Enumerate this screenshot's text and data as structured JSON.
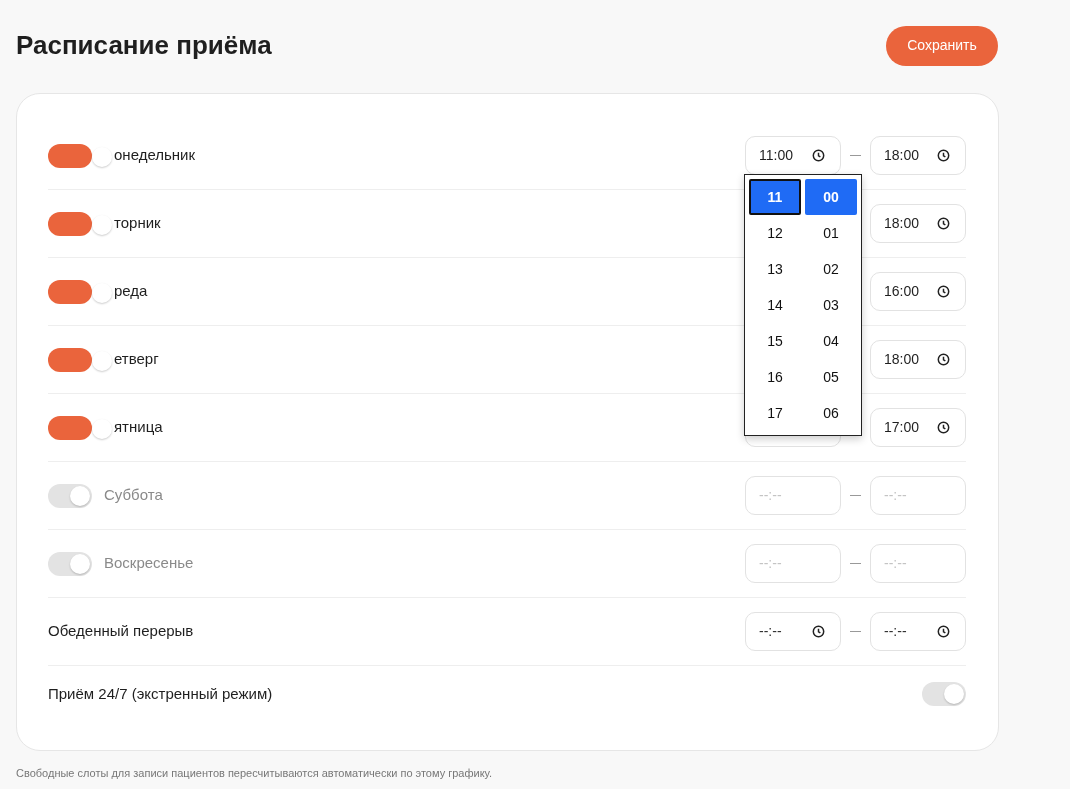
{
  "title": "Расписание приёма",
  "save_button": "Сохранить",
  "days": [
    {
      "label": "онедельник",
      "enabled": true,
      "start": {
        "value": "11:00",
        "expanded": true
      },
      "end": {
        "value": "18:00"
      }
    },
    {
      "label": "торник",
      "enabled": true,
      "end": {
        "value": "18:00"
      }
    },
    {
      "label": "реда",
      "enabled": true,
      "end": {
        "value": "16:00"
      }
    },
    {
      "label": "етверг",
      "enabled": true,
      "end": {
        "value": "18:00"
      }
    },
    {
      "label": "ятница",
      "enabled": true,
      "start": {
        "covered": true
      },
      "end": {
        "value": "17:00"
      }
    },
    {
      "label": "Суббота",
      "enabled": false,
      "start": {
        "placeholder": "--:--"
      },
      "end": {
        "placeholder": "--:--"
      }
    },
    {
      "label": "Воскресенье",
      "enabled": false,
      "start": {
        "placeholder": "--:--"
      },
      "end": {
        "placeholder": "--:--"
      }
    }
  ],
  "lunch_break": {
    "label": "Обеденный перерыв",
    "start": {
      "placeholder": "--:--"
    },
    "end": {
      "placeholder": "--:--"
    }
  },
  "emergency": {
    "label": "Приём 24/7 (экстренный режим)",
    "on": false
  },
  "time_picker": {
    "hours": [
      {
        "text": "11",
        "selected": true
      },
      {
        "text": "12",
        "selected": false
      },
      {
        "text": "13",
        "selected": false
      },
      {
        "text": "14",
        "selected": false
      },
      {
        "text": "15",
        "selected": false
      },
      {
        "text": "16",
        "selected": false
      },
      {
        "text": "17",
        "selected": false
      }
    ],
    "minutes": [
      {
        "text": "00",
        "selected": true
      },
      {
        "text": "01",
        "selected": false
      },
      {
        "text": "02",
        "selected": false
      },
      {
        "text": "03",
        "selected": false
      },
      {
        "text": "04",
        "selected": false
      },
      {
        "text": "05",
        "selected": false
      },
      {
        "text": "06",
        "selected": false
      }
    ]
  },
  "footnote": "Свободные слоты для записи пациентов пересчитываются автоматически по этому графику."
}
